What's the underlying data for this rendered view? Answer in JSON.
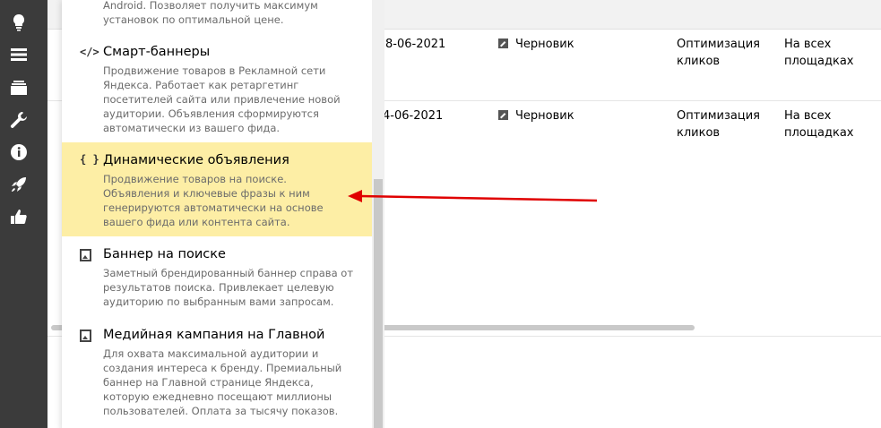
{
  "sidebar": {
    "icons": [
      "lightbulb-icon",
      "list-icon",
      "stack-icon",
      "wrench-icon",
      "info-icon",
      "rocket-icon",
      "thumbs-up-icon"
    ]
  },
  "table": {
    "rows": [
      {
        "date": "8-06-2021",
        "status": "Черновик",
        "strategy": "Оптимизация кликов",
        "placement": "На всех площадках"
      },
      {
        "date": "4-06-2021",
        "status": "Черновик",
        "strategy": "Оптимизация кликов",
        "placement": "На всех площадках"
      }
    ]
  },
  "menu": {
    "items": [
      {
        "title": "",
        "desc": "Android. Позволяет получить максимум установок по оптимальной цене."
      },
      {
        "icon": "</>",
        "title": "Смарт-баннеры",
        "desc": "Продвижение товаров в Рекламной сети Яндекса. Работает как ретаргетинг посетителей сайта или привлечение новой аудитории. Объявления сформируются автоматически из вашего фида."
      },
      {
        "icon": "{ }",
        "title": "Динамические объявления",
        "desc": "Продвижение товаров на поиске. Объявления и ключевые фразы к ним генерируются автоматически на основе вашего фида или контента сайта."
      },
      {
        "title": "Баннер на поиске",
        "desc": "Заметный брендированный баннер справа от результатов поиска. Привлекает целевую аудиторию по выбранным вами запросам."
      },
      {
        "title": "Медийная кампания на Главной",
        "desc": "Для охвата максимальной аудитории и создания интереса к бренду. Премиальный баннер на Главной странице Яндекса, которую ежедневно посещают миллионы пользователей. Оплата за тысячу показов."
      }
    ]
  },
  "colors": {
    "highlight": "#fdeea5",
    "arrow": "#e00000",
    "sidebar": "#3b3b3b"
  }
}
